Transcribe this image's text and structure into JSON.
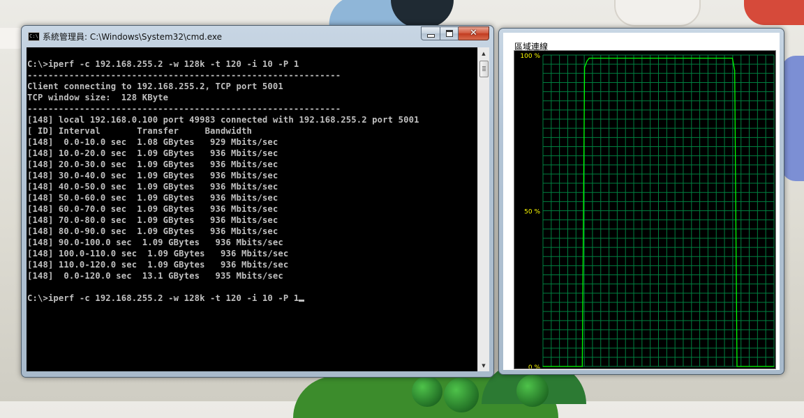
{
  "cmd_window": {
    "title": "系統管理員: C:\\Windows\\System32\\cmd.exe",
    "icon": "cmd-icon",
    "icon_text": "C:\\",
    "buttons": {
      "minimize": "minimize-icon",
      "maximize": "maximize-icon",
      "close": "close-icon"
    },
    "console_lines": [
      "",
      "C:\\>iperf -c 192.168.255.2 -w 128k -t 120 -i 10 -P 1",
      "------------------------------------------------------------",
      "Client connecting to 192.168.255.2, TCP port 5001",
      "TCP window size:  128 KByte",
      "------------------------------------------------------------",
      "[148] local 192.168.0.100 port 49983 connected with 192.168.255.2 port 5001",
      "[ ID] Interval       Transfer     Bandwidth",
      "[148]  0.0-10.0 sec  1.08 GBytes   929 Mbits/sec",
      "[148] 10.0-20.0 sec  1.09 GBytes   936 Mbits/sec",
      "[148] 20.0-30.0 sec  1.09 GBytes   936 Mbits/sec",
      "[148] 30.0-40.0 sec  1.09 GBytes   936 Mbits/sec",
      "[148] 40.0-50.0 sec  1.09 GBytes   936 Mbits/sec",
      "[148] 50.0-60.0 sec  1.09 GBytes   936 Mbits/sec",
      "[148] 60.0-70.0 sec  1.09 GBytes   936 Mbits/sec",
      "[148] 70.0-80.0 sec  1.09 GBytes   936 Mbits/sec",
      "[148] 80.0-90.0 sec  1.09 GBytes   936 Mbits/sec",
      "[148] 90.0-100.0 sec  1.09 GBytes   936 Mbits/sec",
      "[148] 100.0-110.0 sec  1.09 GBytes   936 Mbits/sec",
      "[148] 110.0-120.0 sec  1.09 GBytes   936 Mbits/sec",
      "[148]  0.0-120.0 sec  13.1 GBytes   935 Mbits/sec",
      ""
    ],
    "prompt_line": "C:\\>iperf -c 192.168.255.2 -w 128k -t 120 -i 10 -P 1"
  },
  "graph_window": {
    "label": "區域連線",
    "colors": {
      "background": "#000000",
      "grid": "#008040",
      "line": "#00ff00",
      "tick_labels": "#ffff00"
    }
  },
  "chart_data": {
    "type": "line",
    "title": "區域連線",
    "ylabel": "",
    "xlabel": "",
    "ylim": [
      0,
      100
    ],
    "y_tick_labels": [
      "100 %",
      "50 %",
      "0 %"
    ],
    "y_ticks": [
      100,
      50,
      0
    ],
    "grid": true,
    "x": [
      0,
      17,
      18,
      19,
      20,
      21,
      82,
      83,
      84,
      100
    ],
    "values": [
      0,
      0,
      96,
      98,
      99,
      99,
      99,
      95,
      0,
      0
    ],
    "x_range": [
      0,
      100
    ]
  }
}
